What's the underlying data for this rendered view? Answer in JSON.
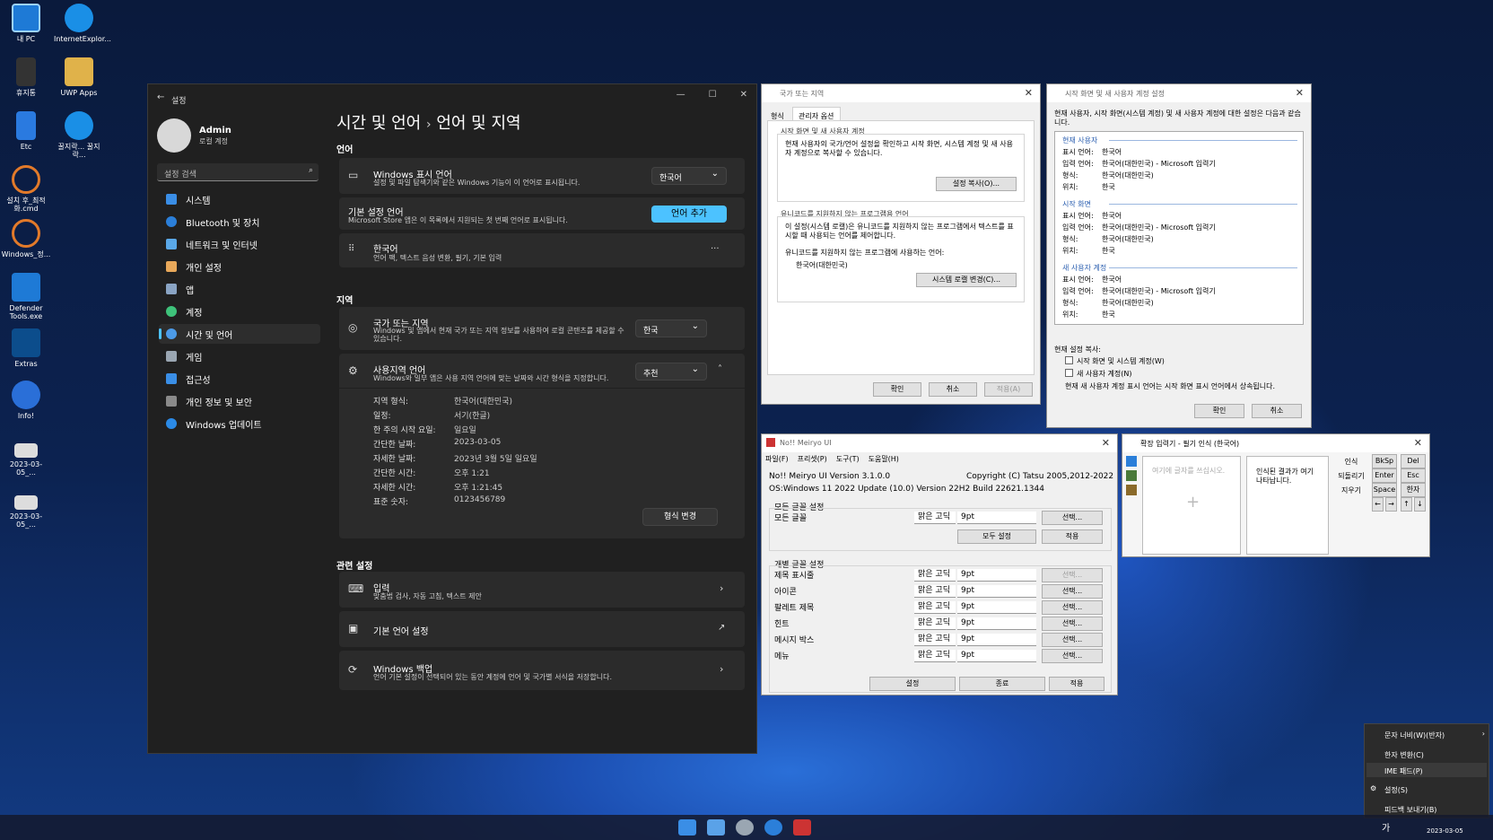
{
  "desktop": {
    "icons": [
      "내 PC",
      "InternetExplor...",
      "휴지통",
      "UWP Apps",
      "Etc",
      "꿀지락... 꿀지락...",
      "설치 후_최적화.cmd",
      "Windows_정...",
      "Defender Tools.exe",
      "Extras",
      "Info!",
      "2023-03-05_...",
      "2023-03-05_..."
    ]
  },
  "settings": {
    "title": "설정",
    "user": {
      "name": "Admin",
      "type": "로컬 계정"
    },
    "search_placeholder": "설정 검색",
    "nav": [
      "시스템",
      "Bluetooth 및 장치",
      "네트워크 및 인터넷",
      "개인 설정",
      "앱",
      "계정",
      "시간 및 언어",
      "게임",
      "접근성",
      "개인 정보 및 보안",
      "Windows 업데이트"
    ],
    "breadcrumb_parent": "시간 및 언어",
    "breadcrumb_sep": "›",
    "page_title": "언어 및 지역",
    "lang_section": "언어",
    "display_lang": {
      "title": "Windows 표시 언어",
      "desc": "설정 및 파일 탐색기와 같은 Windows 기능이 이 언어로 표시됩니다.",
      "value": "한국어"
    },
    "pref_lang": {
      "title": "기본 설정 언어",
      "desc": "Microsoft Store 앱은 이 목록에서 지원되는 첫 번째 언어로 표시됩니다.",
      "button": "언어 추가"
    },
    "korean": {
      "title": "한국어",
      "desc": "언어 팩, 텍스트 음성 변환, 필기, 기본 입력",
      "more": "···"
    },
    "region_section": "지역",
    "country": {
      "title": "국가 또는 지역",
      "desc": "Windows 및 앱에서 현재 국가 또는 지역 정보를 사용하여 로컬 콘텐츠를 제공할 수 있습니다.",
      "value": "한국"
    },
    "regional_format": {
      "title": "사용지역 언어",
      "desc": "Windows와 일부 앱은 사용 지역 언어에 맞는 날짜와 시간 형식을 지정합니다.",
      "value": "추천"
    },
    "formats": [
      [
        "지역 형식:",
        "한국어(대한민국)"
      ],
      [
        "일정:",
        "서기(한글)"
      ],
      [
        "한 주의 시작 요일:",
        "일요일"
      ],
      [
        "간단한 날짜:",
        "2023-03-05"
      ],
      [
        "자세한 날짜:",
        "2023년 3월 5일 일요일"
      ],
      [
        "간단한 시간:",
        "오후 1:21"
      ],
      [
        "자세한 시간:",
        "오후 1:21:45"
      ],
      [
        "표준 숫자:",
        "0123456789"
      ]
    ],
    "change_format": "형식 변경",
    "related_section": "관련 설정",
    "input": {
      "title": "입력",
      "desc": "맞춤법 검사, 자동 고침, 텍스트 제안"
    },
    "admin_lang": {
      "title": "기본 언어 설정"
    },
    "backup": {
      "title": "Windows 백업",
      "desc": "언어 기본 설정이 선택되어 있는 동안 계정에 언어 및 국가별 서식을 저장합니다."
    }
  },
  "region_dlg": {
    "title": "국가 또는 지역",
    "tabs": [
      "형식",
      "관리자 옵션"
    ],
    "g1_title": "시작 화면 및 새 사용자 계정",
    "g1_desc": "현재 사용자의 국가/언어 설정을 확인하고 시작 화면, 시스템 계정 및 새 사용자 계정으로 복사할 수 있습니다.",
    "copy_btn": "설정 복사(O)...",
    "g2_title": "유니코드를 지원하지 않는 프로그램용 언어",
    "g2_desc": "이 설정(시스템 로캘)은 유니코드를 지원하지 않는 프로그램에서 텍스트를 표시할 때 사용되는 언어를 제어합니다.",
    "g2_label": "유니코드를 지원하지 않는 프로그램에 사용하는 언어:",
    "g2_value": "한국어(대한민국)",
    "locale_btn": "시스템 로캘 변경(C)...",
    "ok": "확인",
    "cancel": "취소",
    "apply": "적용(A)"
  },
  "welcome_dlg": {
    "title": "시작 화면 및 새 사용자 계정 설정",
    "intro": "현재 사용자, 시작 화면(시스템 계정) 및 새 사용자 계정에 대한 설정은 다음과 같습니다.",
    "sections": [
      {
        "name": "현재 사용자",
        "rows": [
          [
            "표시 언어:",
            "한국어"
          ],
          [
            "입력 언어:",
            "한국어(대한민국) - Microsoft 입력기"
          ],
          [
            "형식:",
            "한국어(대한민국)"
          ],
          [
            "위치:",
            "한국"
          ]
        ]
      },
      {
        "name": "시작 화면",
        "rows": [
          [
            "표시 언어:",
            "한국어"
          ],
          [
            "입력 언어:",
            "한국어(대한민국) - Microsoft 입력기"
          ],
          [
            "형식:",
            "한국어(대한민국)"
          ],
          [
            "위치:",
            "한국"
          ]
        ]
      },
      {
        "name": "새 사용자 계정",
        "rows": [
          [
            "표시 언어:",
            "한국어"
          ],
          [
            "입력 언어:",
            "한국어(대한민국) - Microsoft 입력기"
          ],
          [
            "형식:",
            "한국어(대한민국)"
          ],
          [
            "위치:",
            "한국"
          ]
        ]
      }
    ],
    "copy_label": "현재 설정 복사:",
    "cb1": "시작 화면 및 시스템 계정(W)",
    "cb2": "새 사용자 계정(N)",
    "note": "현재 새 사용자 계정 표시 언어는 시작 화면 표시 언어에서 상속됩니다.",
    "ok": "확인",
    "cancel": "취소"
  },
  "meiryo": {
    "title": "No!! Meiryo UI",
    "menu": [
      "파일(F)",
      "프리셋(P)",
      "도구(T)",
      "도움말(H)"
    ],
    "version": "No!! Meiryo UI Version 3.1.0.0",
    "copyright": "Copyright (C) Tatsu 2005,2012-2022",
    "os": "OS:Windows 11 2022 Update (10.0) Version 22H2 Build 22621.1344",
    "all_group": "모든 글꼴 설정",
    "all_label": "모든 글꼴",
    "font": "맑은 고딕",
    "size": "9pt",
    "select": "선택...",
    "set_all": "모두 설정",
    "apply": "적용",
    "each_group": "개별 글꼴 설정",
    "items": [
      "제목 표시줄",
      "아이콘",
      "팔레트 제목",
      "힌트",
      "메시지 박스",
      "메뉴"
    ],
    "btn_set": "설정",
    "btn_exit": "종료",
    "btn_apply": "적용"
  },
  "ime_pad": {
    "title": "확장 입력기 - 필기 인식 (한국어)",
    "write_hint": "여기에 글자를 쓰십시오.",
    "result_hint": "인식된 결과가 여기 나타납니다.",
    "btns": [
      "인식",
      "되돌리기",
      "지우기"
    ],
    "keys": [
      "BkSp",
      "Del",
      "Enter",
      "Esc",
      "Space",
      "한자",
      "←",
      "→",
      "↑",
      "↓"
    ]
  },
  "ctx_menu": [
    "문자 너비(W)(반자)",
    "한자 변환(C)",
    "IME 패드(P)",
    "설정(S)",
    "피드백 보내기(B)"
  ],
  "tray": {
    "ime": "가",
    "date": "2023-03-05"
  }
}
